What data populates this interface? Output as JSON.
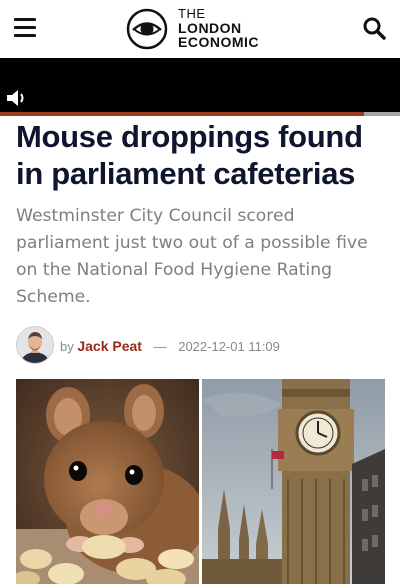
{
  "header": {
    "logo_line1": "THE",
    "logo_line2": "LONDON",
    "logo_line3": "ECONOMIC",
    "menu_icon": "hamburger-icon",
    "search_icon": "search-icon"
  },
  "video": {
    "mute_icon": "speaker-icon",
    "progress": 0.91
  },
  "article": {
    "headline": "Mouse droppings found in parliament cafeterias",
    "standfirst": "Westminster City Council scored parliament just two out of a possible five on the National Food Hygiene Rating Scheme.",
    "byline_prefix": "by",
    "author": "Jack Peat",
    "separator": "—",
    "date": "2022-12-01 11:09"
  },
  "colors": {
    "headline": "#10152f",
    "author": "#9b2a17",
    "progress_fill": "#9b3b1e"
  }
}
